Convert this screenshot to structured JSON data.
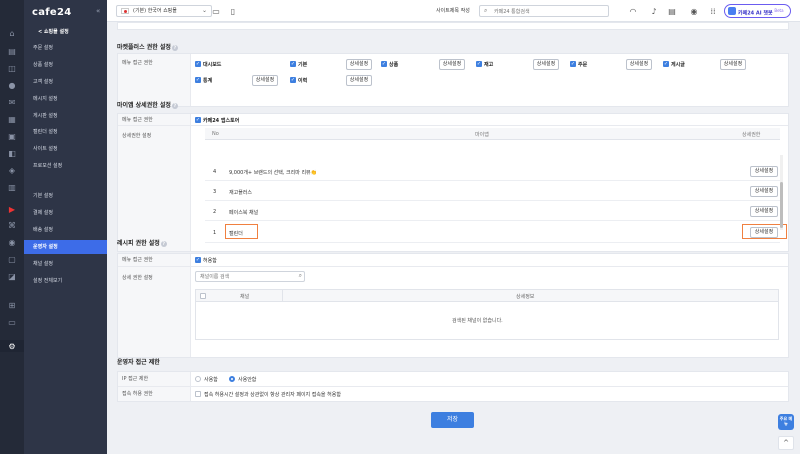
{
  "brand": {
    "logo": "cafe24"
  },
  "topbar": {
    "shop_select": "(기본) 한국어 쇼핑몰",
    "site_title_label": "사이트제목 작성",
    "search_placeholder": "카페24 통합검색",
    "ai_button": "카페24 AI 챗봇",
    "ai_beta": "Beta"
  },
  "nav": {
    "back": "< 쇼핑몰 설정",
    "items": [
      "주문 설정",
      "상품 설정",
      "고객 설정",
      "메시지 설정",
      "게시판 설정",
      "캘린더 설정",
      "사이트 설정",
      "프로모션 설정",
      "기본 설정",
      "결제 설정",
      "배송 설정",
      "운영자 설정",
      "채널 설정",
      "설정 전체보기"
    ],
    "active": "운영자 설정"
  },
  "marketplace": {
    "title": "마켓플러스 권한 설정",
    "menu_access_label": "메뉴 접근 권한",
    "items": [
      {
        "label": "대시보드",
        "has_button": false
      },
      {
        "label": "기본",
        "has_button": true
      },
      {
        "label": "상품",
        "has_button": true
      },
      {
        "label": "재고",
        "has_button": true
      },
      {
        "label": "주문",
        "has_button": true
      },
      {
        "label": "게시글",
        "has_button": true
      },
      {
        "label": "통계",
        "has_button": true
      },
      {
        "label": "이력",
        "has_button": true
      }
    ],
    "detail_button": "상세설정"
  },
  "myapp": {
    "title": "마이앱 상세권한 설정",
    "menu_access_label": "메뉴 접근 권한",
    "menu_access_value": "카페24 앱스토어",
    "detail_label": "상세권한 설정",
    "columns": [
      "No",
      "마이앱",
      "상세권한"
    ],
    "rows": [
      {
        "no": "4",
        "name": "9,000개+ 브랜드의 선택, 크리마 리뷰👏"
      },
      {
        "no": "3",
        "name": "재고플러스"
      },
      {
        "no": "2",
        "name": "페이스북 채널"
      },
      {
        "no": "1",
        "name": "캘린더"
      }
    ],
    "detail_button": "상세설정"
  },
  "legacy": {
    "title": "레시피 권한 설정",
    "menu_access_label": "메뉴 접근 권한",
    "menu_access_value": "허용함",
    "detail_label": "상세 권한 설정",
    "search_placeholder": "채널이름 검색",
    "columns": [
      "채널",
      "상세정보"
    ],
    "empty": "검색된 채널이 없습니다."
  },
  "operator": {
    "title": "운영자 접근 제한",
    "ip_label": "IP 접근 제한",
    "ip_options": [
      "사용함",
      "사용안함"
    ],
    "ip_selected": "사용안함",
    "login_label": "접속 허용 권한",
    "login_option": "접속 허용시간 설정과 상관없이 항상 관리자 페이지 접속을 허용함"
  },
  "actions": {
    "save": "저장",
    "float_menu": "주요 메뉴",
    "top": "^"
  },
  "colors": {
    "accent": "#3d7fe0",
    "highlight": "#f08040",
    "nav_bg": "#2e3547"
  }
}
